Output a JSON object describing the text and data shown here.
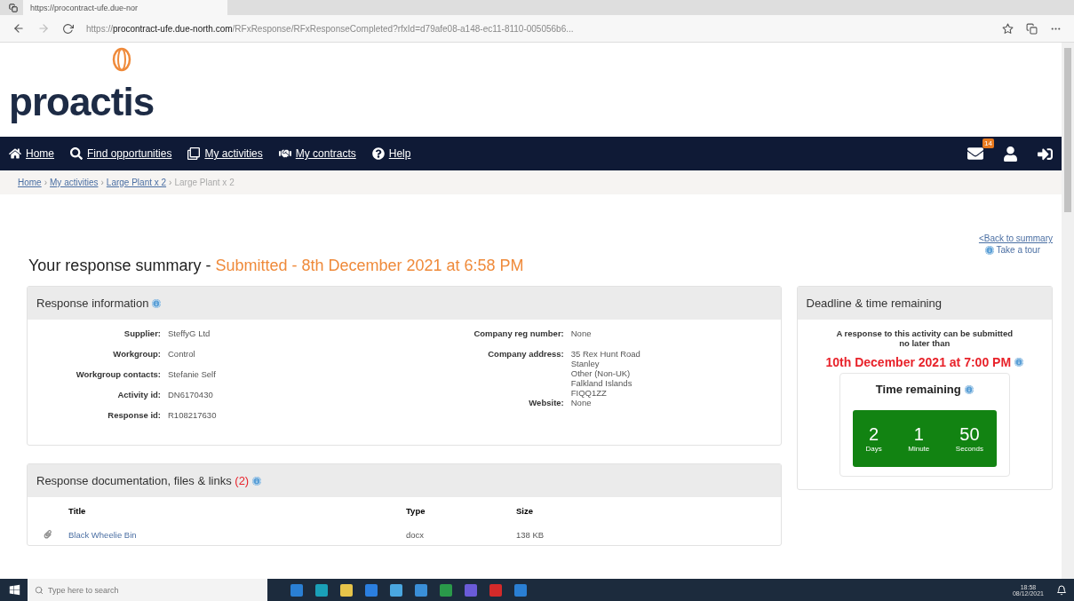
{
  "browser": {
    "tab_title": "https://procontract-ufe.due-nor",
    "url": "https://**procontract-ufe.due-north.com**/RFxResponse/RFxResponseCompleted?rfxId=d79afe08-a148-ec11-8110-005056b6..."
  },
  "logo": {
    "text": "proactis"
  },
  "nav": {
    "items": [
      {
        "kind": "home",
        "label": "Home"
      },
      {
        "kind": "search",
        "label": "Find opportunities"
      },
      {
        "kind": "copy",
        "label": "My activities"
      },
      {
        "kind": "contracts",
        "label": "My contracts"
      },
      {
        "kind": "help",
        "label": "Help"
      }
    ],
    "mail_badge": "14"
  },
  "breadcrumb_separator": "›",
  "breadcrumb": [
    {
      "label": "Home",
      "current": false
    },
    {
      "label": "My activities",
      "current": false
    },
    {
      "label": "Large Plant x 2",
      "current": false
    },
    {
      "label": "Large Plant x 2",
      "current": true
    }
  ],
  "links": {
    "back": "<Back to summary",
    "tour": "Take a tour"
  },
  "title": {
    "text": "Your response summary - ",
    "status": "Submitted - 8th December 2021 at 6:58 PM"
  },
  "response_info": {
    "title": "Response information",
    "left": [
      {
        "label": "Supplier:",
        "value": "SteffyG Ltd"
      },
      {
        "label": "Workgroup:",
        "value": "Control"
      },
      {
        "label": "Workgroup contacts:",
        "value": "Stefanie Self"
      },
      {
        "label": "Activity id:",
        "value": "DN6170430"
      },
      {
        "label": "Response id:",
        "value": "R108217630"
      }
    ],
    "right": [
      {
        "label": "Company reg number:",
        "lines": [
          "None"
        ]
      },
      {
        "label": "Company address:",
        "lines": [
          "35 Rex Hunt Road",
          "Stanley",
          "Other (Non-UK)",
          "Falkland Islands",
          "FIQQ1ZZ"
        ]
      },
      {
        "label": "Website:",
        "lines": [
          "None"
        ]
      }
    ]
  },
  "deadline": {
    "title": "Deadline & time remaining",
    "note": "A response to this activity can be submitted no later than",
    "date": "10th December 2021 at 7:00 PM",
    "remaining_title": "Time remaining",
    "countdown": [
      {
        "value": "2",
        "unit": "Days"
      },
      {
        "value": "1",
        "unit": "Minute"
      },
      {
        "value": "50",
        "unit": "Seconds"
      }
    ]
  },
  "documents": {
    "title": "Response documentation, files & links",
    "count": "(2)",
    "columns": [
      "Title",
      "Type",
      "Size"
    ],
    "rows": [
      {
        "title": "Black Wheelie Bin",
        "type": "docx",
        "size": "138 KB"
      }
    ]
  },
  "taskbar": {
    "search_placeholder": "Type here to search",
    "time": "18:58",
    "date": "08/12/2021"
  }
}
